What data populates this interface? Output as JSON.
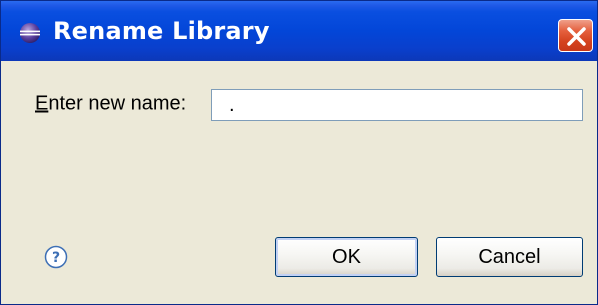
{
  "window": {
    "title": "Rename Library",
    "title_icon": "eclipse-icon",
    "close_icon": "close-icon"
  },
  "form": {
    "label_mnemonic": "E",
    "label_rest": "nter new name:",
    "input_value": "."
  },
  "footer": {
    "help_icon": "help-icon",
    "ok_label": "OK",
    "cancel_label": "Cancel"
  },
  "colors": {
    "titlebar": "#0346d8",
    "dialog_bg": "#ece9d8",
    "close_button": "#d4421e",
    "input_border": "#7f9db9",
    "button_border": "#003c74"
  }
}
